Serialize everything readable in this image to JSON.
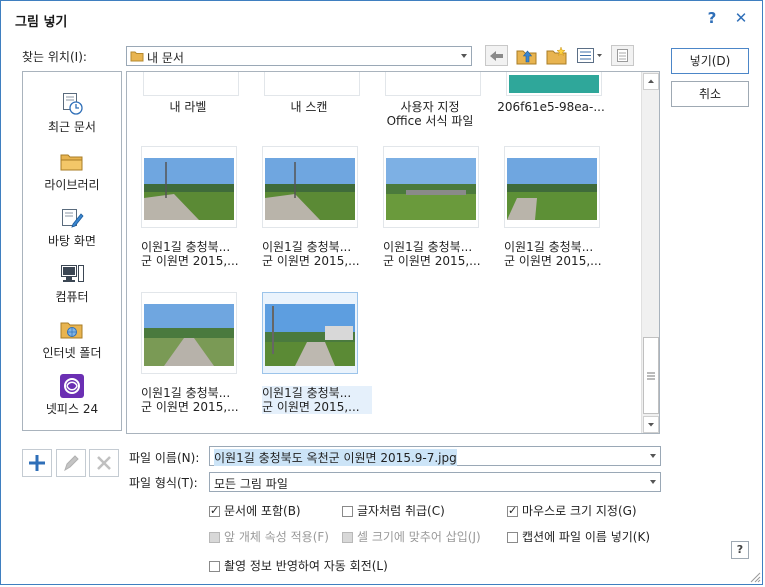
{
  "window": {
    "title": "그림 넣기",
    "help_label": "?",
    "close_label": "✕"
  },
  "location": {
    "label": "찾는 위치(I):",
    "value": "내 문서"
  },
  "buttons": {
    "insert": "넣기(D)",
    "cancel": "취소",
    "help": "?"
  },
  "places": [
    {
      "label": "최근 문서",
      "icon": "recent-documents-icon"
    },
    {
      "label": "라이브러리",
      "icon": "library-folder-icon"
    },
    {
      "label": "바탕 화면",
      "icon": "desktop-icon"
    },
    {
      "label": "컴퓨터",
      "icon": "computer-icon"
    },
    {
      "label": "인터넷 폴더",
      "icon": "internet-folder-icon"
    },
    {
      "label": "넷피스 24",
      "icon": "netffice-icon"
    }
  ],
  "files": [
    {
      "line1": "내 라벨",
      "line2": ""
    },
    {
      "line1": "내 스캔",
      "line2": ""
    },
    {
      "line1": "사용자 지정",
      "line2": "Office 서식 파일"
    },
    {
      "line1": "206f61e5-98ea-...",
      "line2": ""
    },
    {
      "line1": "이원1길 충청북...",
      "line2": "군 이원면 2015,..."
    },
    {
      "line1": "이원1길 충청북...",
      "line2": "군 이원면 2015,..."
    },
    {
      "line1": "이원1길 충청북...",
      "line2": "군 이원면 2015,..."
    },
    {
      "line1": "이원1길 충청북...",
      "line2": "군 이원면 2015,..."
    },
    {
      "line1": "이원1길 충청북...",
      "line2": "군 이원면 2015,..."
    },
    {
      "line1": "이원1길 충청북...",
      "line2": "군 이원면 2015,..."
    }
  ],
  "filename": {
    "label": "파일 이름(N):",
    "value": "이원1길 충청북도 옥천군 이원면 2015.9-7.jpg"
  },
  "filetype": {
    "label": "파일 형식(T):",
    "value": "모든 그림 파일"
  },
  "options": {
    "include_in_doc": {
      "label": "문서에 포함(B)",
      "checked": true
    },
    "as_char": {
      "label": "글자처럼 취급(C)",
      "checked": false
    },
    "mouse_size": {
      "label": "마우스로 크기 지정(G)",
      "checked": true
    },
    "apply_prev": {
      "label": "앞 개체 속성 적용(F)",
      "checked": false
    },
    "fit_cell": {
      "label": "셀 크기에 맞추어 삽입(J)",
      "checked": false
    },
    "caption_filename": {
      "label": "캡션에 파일 이름 넣기(K)",
      "checked": false
    },
    "auto_rotate": {
      "label": "촬영 정보 반영하여 자동 회전(L)",
      "checked": false
    }
  }
}
